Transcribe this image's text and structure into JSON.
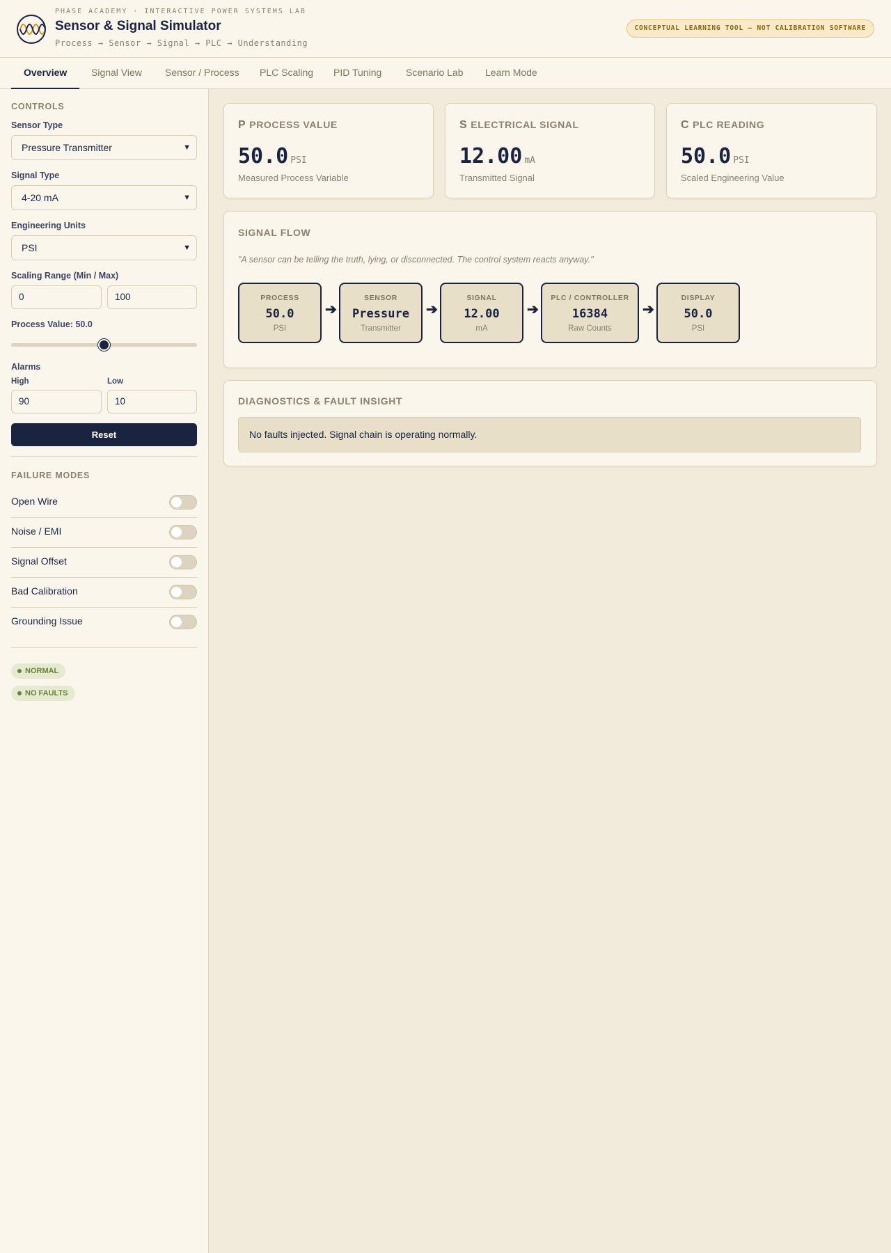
{
  "header": {
    "eyebrow": "PHASE ACADEMY · INTERACTIVE POWER SYSTEMS LAB",
    "title": "Sensor & Signal Simulator",
    "subtitle": "Process → Sensor → Signal → PLC → Understanding",
    "disclaimer": "CONCEPTUAL LEARNING TOOL — NOT CALIBRATION SOFTWARE",
    "logo_icon": "sine-wave-logo-icon"
  },
  "tabs": [
    {
      "label": "Overview",
      "active": true
    },
    {
      "label": "Signal View"
    },
    {
      "label": "Sensor / Process"
    },
    {
      "label": "PLC Scaling"
    },
    {
      "label": "PID Tuning"
    },
    {
      "label": "Scenario Lab"
    },
    {
      "label": "Learn Mode"
    }
  ],
  "controls": {
    "title": "CONTROLS",
    "sensor_type": {
      "label": "Sensor Type",
      "value": "Pressure Transmitter"
    },
    "signal_type": {
      "label": "Signal Type",
      "value": "4-20 mA"
    },
    "units": {
      "label": "Engineering Units",
      "value": "PSI"
    },
    "scaling": {
      "label": "Scaling Range (Min / Max)",
      "min": "0",
      "max": "100"
    },
    "process_value": {
      "label": "Process Value:",
      "value": "50.0",
      "fraction": 0.5
    },
    "alarms": {
      "label": "Alarms",
      "high_label": "High",
      "high": "90",
      "low_label": "Low",
      "low": "10"
    },
    "reset_label": "Reset"
  },
  "failure_modes": {
    "title": "FAILURE MODES",
    "items": [
      {
        "label": "Open Wire",
        "on": false
      },
      {
        "label": "Noise / EMI",
        "on": false
      },
      {
        "label": "Signal Offset",
        "on": false
      },
      {
        "label": "Bad Calibration",
        "on": false
      },
      {
        "label": "Grounding Issue",
        "on": false
      }
    ]
  },
  "status": {
    "state": "NORMAL",
    "faults": "NO FAULTS"
  },
  "cards": [
    {
      "letter": "P",
      "title": "PROCESS VALUE",
      "value": "50.0",
      "unit": "PSI",
      "desc": "Measured Process Variable"
    },
    {
      "letter": "S",
      "title": "ELECTRICAL SIGNAL",
      "value": "12.00",
      "unit": "mA",
      "desc": "Transmitted Signal"
    },
    {
      "letter": "C",
      "title": "PLC READING",
      "value": "50.0",
      "unit": "PSI",
      "desc": "Scaled Engineering Value"
    }
  ],
  "signal_flow": {
    "title": "SIGNAL FLOW",
    "quote": "\"A sensor can be telling the truth, lying, or disconnected. The control system reacts anyway.\"",
    "steps": [
      {
        "caption": "PROCESS",
        "value": "50.0",
        "sub": "PSI"
      },
      {
        "caption": "SENSOR",
        "value": "Pressure",
        "sub": "Transmitter"
      },
      {
        "caption": "SIGNAL",
        "value": "12.00",
        "sub": "mA"
      },
      {
        "caption": "PLC / CONTROLLER",
        "value": "16384",
        "sub": "Raw Counts"
      },
      {
        "caption": "DISPLAY",
        "value": "50.0",
        "sub": "PSI"
      }
    ],
    "arrow": "➔"
  },
  "diagnostics": {
    "title": "DIAGNOSTICS & FAULT INSIGHT",
    "message": "No faults injected. Signal chain is operating normally."
  },
  "colors": {
    "navy": "#1a2440",
    "background": "#f2ebdc",
    "panel": "#faf6ec",
    "status_green": "#6b7f3a",
    "disclaimer_amber": "#8a6318"
  }
}
